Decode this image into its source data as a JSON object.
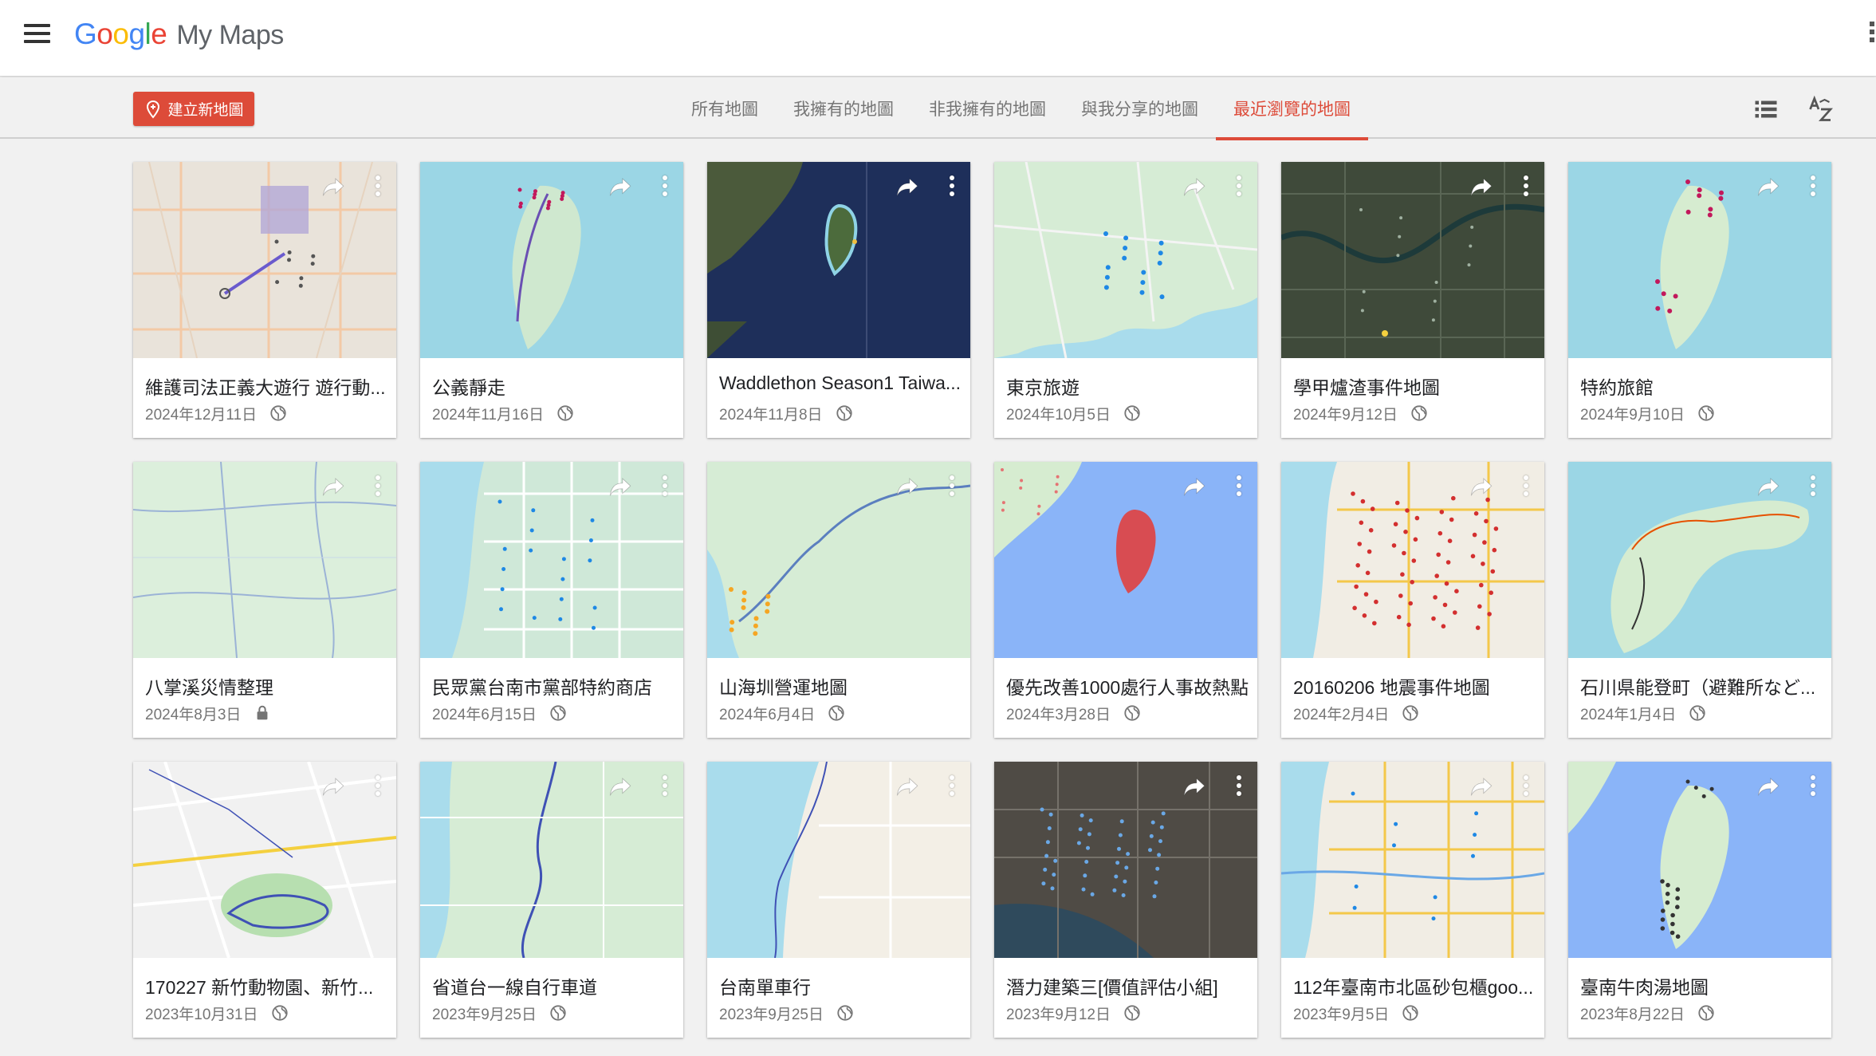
{
  "header": {
    "logo_google": [
      "G",
      "o",
      "o",
      "g",
      "l",
      "e"
    ],
    "product": "My Maps"
  },
  "toolbar": {
    "create_label": "建立新地圖",
    "tabs": [
      {
        "label": "所有地圖",
        "active": false
      },
      {
        "label": "我擁有的地圖",
        "active": false
      },
      {
        "label": "非我擁有的地圖",
        "active": false
      },
      {
        "label": "與我分享的地圖",
        "active": false
      },
      {
        "label": "最近瀏覽的地圖",
        "active": true
      }
    ],
    "view_icon": "list-view-icon",
    "sort_icon": "sort-az-icon"
  },
  "colors": {
    "accent": "#dd4b39",
    "google_blue": "#4285f4",
    "google_red": "#ea4335",
    "google_yellow": "#fbbc05",
    "google_green": "#34a853"
  },
  "maps": [
    {
      "title": "維護司法正義大遊行 遊行動...",
      "date": "2024年12月11日",
      "visibility": "public",
      "thumb": "street-beige"
    },
    {
      "title": "公義靜走",
      "date": "2024年11月16日",
      "visibility": "public",
      "thumb": "taiwan-line"
    },
    {
      "title": "Waddlethon Season1 Taiwa...",
      "date": "2024年11月8日",
      "visibility": "public",
      "thumb": "satellite-taiwan"
    },
    {
      "title": "東京旅遊",
      "date": "2024年10月5日",
      "visibility": "public",
      "thumb": "japan-kanto"
    },
    {
      "title": "學甲爐渣事件地圖",
      "date": "2024年9月12日",
      "visibility": "public",
      "thumb": "satellite-field"
    },
    {
      "title": "特約旅館",
      "date": "2024年9月10日",
      "visibility": "public",
      "thumb": "taiwan-pins"
    },
    {
      "title": "八掌溪災情整理",
      "date": "2024年8月3日",
      "visibility": "private",
      "thumb": "plain-roads"
    },
    {
      "title": "民眾黨台南市黨部特約商店",
      "date": "2024年6月15日",
      "visibility": "public",
      "thumb": "city-grid"
    },
    {
      "title": "山海圳營運地圖",
      "date": "2024年6月4日",
      "visibility": "public",
      "thumb": "coast-route"
    },
    {
      "title": "優先改善1000處行人事故熱點",
      "date": "2024年3月28日",
      "visibility": "public",
      "thumb": "taiwan-red"
    },
    {
      "title": "20160206 地震事件地圖",
      "date": "2024年2月4日",
      "visibility": "public",
      "thumb": "red-dots"
    },
    {
      "title": "石川県能登町（避難所など...",
      "date": "2024年1月4日",
      "visibility": "public",
      "thumb": "noto"
    },
    {
      "title": "170227 新竹動物園、新竹...",
      "date": "2023年10月31日",
      "visibility": "public",
      "thumb": "park-route"
    },
    {
      "title": "省道台一線自行車道",
      "date": "2023年9月25日",
      "visibility": "public",
      "thumb": "blue-route"
    },
    {
      "title": "台南單車行",
      "date": "2023年9月25日",
      "visibility": "public",
      "thumb": "coast-plain"
    },
    {
      "title": "潛力建築三[價值評估小組]",
      "date": "2023年9月12日",
      "visibility": "public",
      "thumb": "satellite-city"
    },
    {
      "title": "112年臺南市北區砂包櫃goo...",
      "date": "2023年9月5日",
      "visibility": "public",
      "thumb": "city-roads"
    },
    {
      "title": "臺南牛肉湯地圖",
      "date": "2023年8月22日",
      "visibility": "public",
      "thumb": "taiwan-dark"
    }
  ]
}
